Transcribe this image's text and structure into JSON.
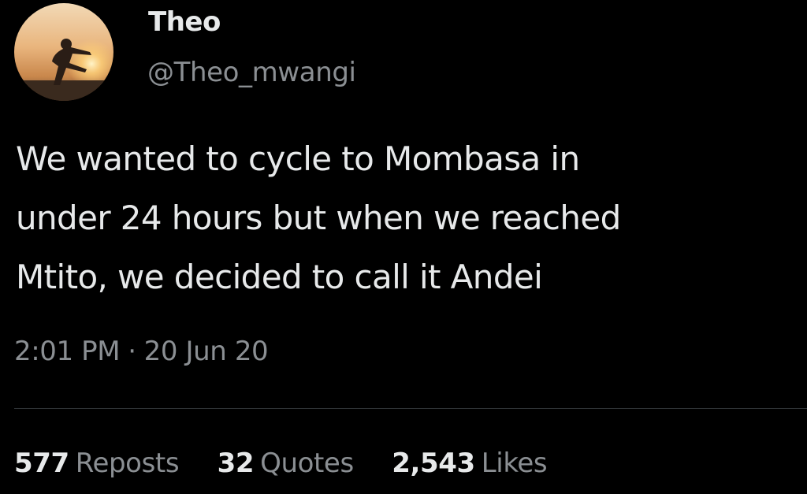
{
  "colors": {
    "background": "#000000",
    "primary_text": "#e7e9ea",
    "secondary_text": "#8b8f93",
    "divider": "#2f3336"
  },
  "author": {
    "display_name": "Theo",
    "handle": "@Theo_mwangi",
    "avatar_icon": "profile-photo-silhouette-at-sunset"
  },
  "tweet": {
    "text_lines": [
      "We wanted to cycle to Mombasa in",
      "under 24 hours but when we reached",
      "Mtito, we decided to call it Andei"
    ],
    "time": "2:01 PM",
    "separator": "·",
    "date": "20 Jun 20"
  },
  "stats": {
    "reposts": {
      "count": "577",
      "label": "Reposts"
    },
    "quotes": {
      "count": "32",
      "label": "Quotes"
    },
    "likes": {
      "count": "2,543",
      "label": "Likes"
    }
  }
}
